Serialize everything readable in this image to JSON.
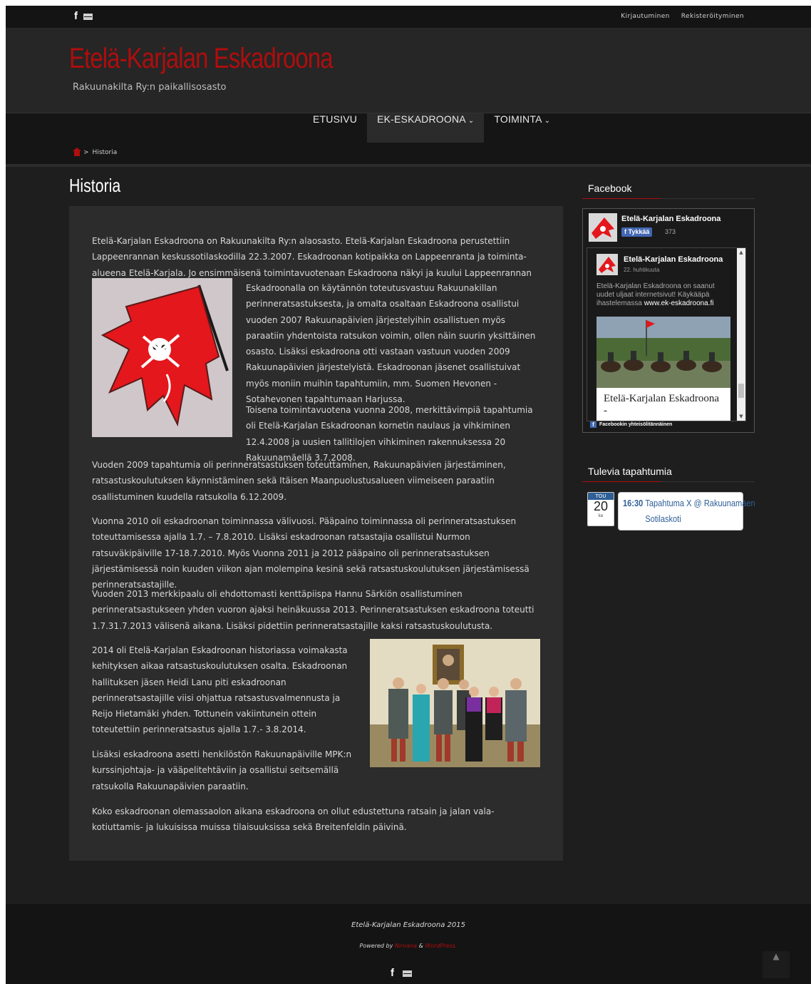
{
  "topbar": {
    "social": [
      "facebook-icon",
      "mail-icon"
    ],
    "links": [
      "Kirjautuminen",
      "Rekisteröityminen"
    ]
  },
  "header": {
    "title": "Etelä-Karjalan Eskadroona",
    "subtitle": "Rakuunakilta Ry:n paikallisosasto"
  },
  "nav": {
    "items": [
      "ETUSIVU",
      "EK-ESKADROONA",
      "TOIMINTA"
    ],
    "active": "EK-ESKADROONA"
  },
  "breadcrumb": {
    "separator": ">",
    "current": "Historia"
  },
  "page": {
    "title": "Historia",
    "paragraphs": [
      "Etelä-Karjalan Eskadroona on Rakuunakilta Ry:n alaosasto. Etelä-Karjalan Eskadroona perustettiin Lappeenrannan keskussotilaskodilla 22.3.2007. Eskadroonan kotipaikka on Lappeenranta ja toiminta-alueena Etelä-Karjala. Jo ensimmäisenä toimintavuotenaan Eskadroona näkyi ja kuului Lappeenrannan kaduilla - ja vähän muuallakin.",
      "Eskadroonalla on käytännön toteutusvastuu Rakuunakillan perinneratsastuksesta, ja omalta osaltaan Eskadroona osallistui vuoden 2007 Rakuunapäivien järjestelyihin osallistuen myös paraatiin yhdentoista ratsukon voimin, ollen näin suurin yksittäinen osasto. Lisäksi eskadroona otti vastaan vastuun vuoden 2009 Rakuunapäivien järjestelyistä. Eskadroonan jäsenet osallistuivat myös moniin muihin tapahtumiin, mm. Suomen Hevonen - Sotahevonen tapahtumaan Harjussa.",
      "Toisena toimintavuotena vuonna 2008, merkittävimpiä tapahtumia oli Etelä-Karjalan Eskadroonan kornetin naulaus ja vihkiminen 12.4.2008 ja uusien tallitilojen vihkiminen rakennuksessa 20 Rakuunamäellä 3.7.2008.",
      "Vuoden 2009 tapahtumia oli perinneratsastuksen toteuttaminen, Rakuunapäivien järjestäminen, ratsastuskoulutuksen käynnistäminen sekä Itäisen Maanpuolustusalueen viimeiseen paraatiin osallistuminen kuudella ratsukolla 6.12.2009.",
      "Vuonna 2010 oli eskadroonan toiminnassa välivuosi. Pääpaino toiminnassa oli perinneratsastuksen toteuttamisessa ajalla 1.7. – 7.8.2010. Lisäksi eskadroonan ratsastajia osallistui Nurmon ratsuväkipäiville 17-18.7.2010. Myös Vuonna 2011 ja 2012 pääpaino oli perinneratsastuksen järjestämisessä noin kuuden viikon ajan molempina kesinä sekä ratsastuskoulutuksen järjestämisessä perinneratsastajille.",
      "Vuoden 2013 merkkipaalu oli ehdottomasti kenttäpiispa Hannu Särkiön osallistuminen perinneratsastukseen yhden vuoron ajaksi heinäkuussa 2013. Perinneratsastuksen eskadroona toteutti 1.7.31.7.2013 välisenä aikana. Lisäksi pidettiin perinneratsastajille kaksi ratsastuskoulutusta.",
      "2014 oli Etelä-Karjalan Eskadroonan historiassa voimakasta kehityksen aikaa ratsastuskoulutuksen osalta. Eskadroonan hallituksen jäsen Heidi Lanu piti eskadroonan perinneratsastajille viisi ohjattua ratsastusvalmennusta ja Reijo Hietamäki yhden. Tottunein vakiintunein ottein toteutettiin perinneratsastus ajalla 1.7.- 3.8.2014.",
      "Lisäksi eskadroona asetti henkilöstön Rakuunapäiville MPK:n kurssinjohtaja- ja vääpelitehtäviin ja osallistui seitsemällä ratsukolla Rakuunapäivien paraatiin.",
      "Koko eskadroonan olemassaolon aikana eskadroona on ollut edustettuna ratsain ja jalan vala- kotiuttamis- ja lukuisissa muissa tilaisuuksissa sekä Breitenfeldin päivinä."
    ]
  },
  "sidebar": {
    "facebook": {
      "title": "Facebook",
      "page_name": "Etelä-Karjalan Eskadroona",
      "like_label": "Tykkää",
      "like_count": "373",
      "post_name": "Etelä-Karjalan Eskadroona",
      "post_date": "22. huhtikuuta",
      "post_text": "Etelä-Karjalan Eskadroona on saanut uudet uljaat internetsivut! Käykääpä ihastelemassa",
      "post_link": "www.ek-eskadroona.fi",
      "card_title": "Etelä-Karjalan Eskadroona -",
      "footer": "Facebookin yhteisölitännäinen"
    },
    "events": {
      "title": "Tulevia tapahtumia",
      "month": "TOU",
      "day": "20",
      "weekday": "ke",
      "time": "16:30",
      "text": "Tapahtuma X @ Rakuunamäen Sotilaskoti"
    }
  },
  "footer": {
    "copyright": "Etelä-Karjalan Eskadroona 2015",
    "powered_prefix": "Powered by",
    "powered_theme": "Nirvana",
    "powered_amp": "&",
    "powered_wp": "WordPress."
  },
  "colors": {
    "accent": "#b00d0d",
    "background": "#1e1e1e",
    "panel": "#2c2c2c",
    "fb_blue": "#4267b2"
  }
}
